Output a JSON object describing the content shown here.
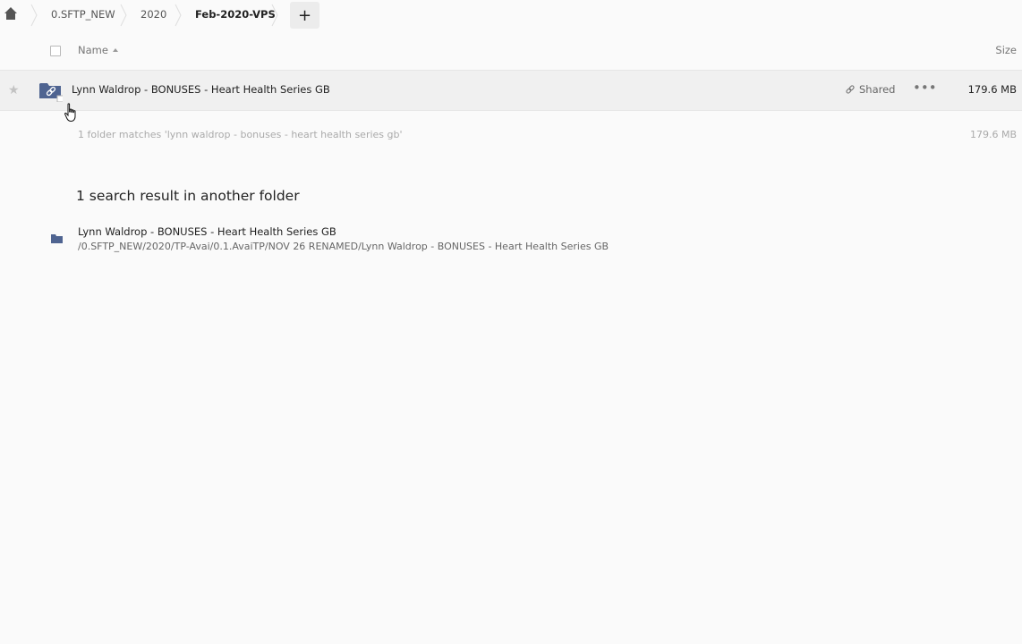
{
  "breadcrumb": {
    "home_icon": "home-icon",
    "items": [
      "0.SFTP_NEW",
      "2020",
      "Feb-2020-VPS"
    ],
    "add_label": "+"
  },
  "table_header": {
    "name_label": "Name",
    "size_label": "Size"
  },
  "file_row": {
    "name": "Lynn Waldrop - BONUSES - Heart Health Series GB",
    "shared_label": "Shared",
    "more_label": "•••",
    "size": "179.6 MB"
  },
  "summary": {
    "text": "1 folder matches 'lynn waldrop - bonuses - heart health series gb'",
    "size": "179.6 MB"
  },
  "other_results": {
    "title": "1 search result in another folder",
    "items": [
      {
        "name": "Lynn Waldrop - BONUSES - Heart Health Series GB",
        "path": "/0.SFTP_NEW/2020/TP-Avai/0.1.AvaiTP/NOV 26 RENAMED/Lynn Waldrop - BONUSES - Heart Health Series GB"
      }
    ]
  },
  "colors": {
    "folder": "#4f6491",
    "row_highlight": "#f0f0f0",
    "background": "#fafafa"
  }
}
